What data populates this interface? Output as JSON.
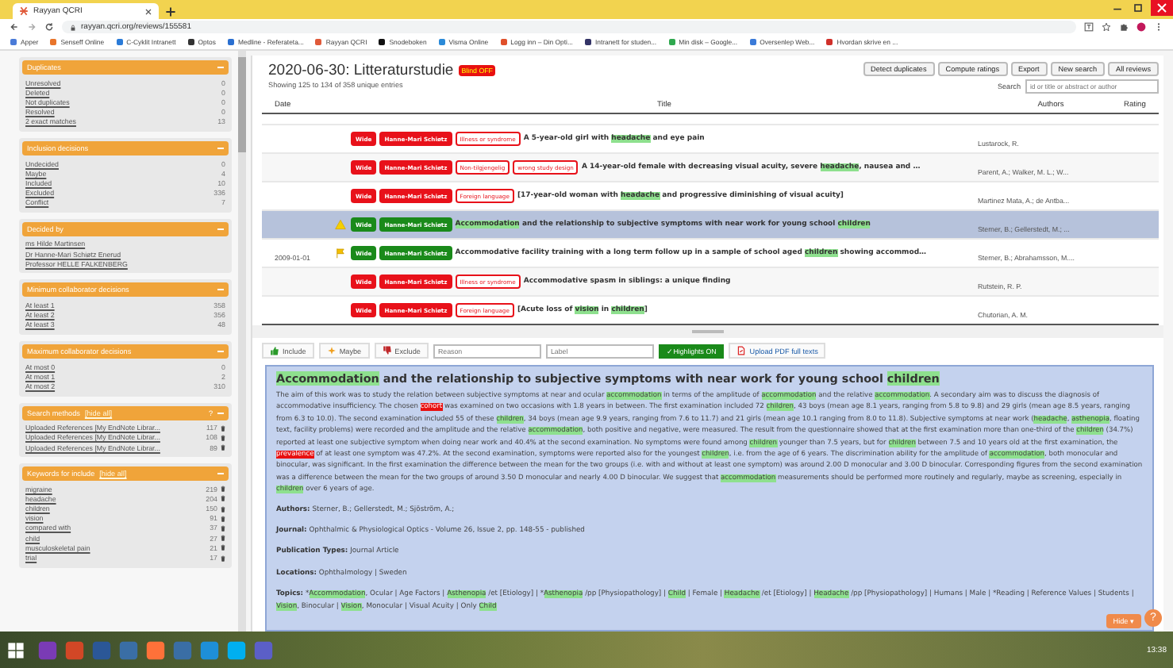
{
  "browser": {
    "tab": {
      "title": "Rayyan QCRI"
    },
    "url": "rayyan.qcri.org/reviews/155581",
    "bookmarks": [
      {
        "label": "Apper",
        "color": "#4a7bd8"
      },
      {
        "label": "Senseff Online",
        "color": "#e8742a"
      },
      {
        "label": "C-Cyklit Intranett",
        "color": "#2a7bd8"
      },
      {
        "label": "Optos",
        "color": "#333333"
      },
      {
        "label": "Medline - Referateta...",
        "color": "#2a6fd0"
      },
      {
        "label": "Rayyan QCRI",
        "color": "#e05a3a"
      },
      {
        "label": "Snodeboken",
        "color": "#111111"
      },
      {
        "label": "Visma Online",
        "color": "#2a8ad8"
      },
      {
        "label": "Logg inn – Din Opti...",
        "color": "#e0502a"
      },
      {
        "label": "Intranett for studen...",
        "color": "#333366"
      },
      {
        "label": "Min disk – Google...",
        "color": "#2fa84f"
      },
      {
        "label": "Oversenlep Web...",
        "color": "#3a7ad8"
      },
      {
        "label": "Hvordan skrive en ...",
        "color": "#d0302a"
      }
    ]
  },
  "sidebar": {
    "panels": [
      {
        "title": "Duplicates",
        "deletable": false,
        "items": [
          {
            "label": "Unresolved",
            "count": "0"
          },
          {
            "label": "Deleted",
            "count": "0"
          },
          {
            "label": "Not duplicates",
            "count": "0"
          },
          {
            "label": "Resolved",
            "count": "0"
          },
          {
            "label": "2 exact matches",
            "count": "13"
          }
        ]
      },
      {
        "title": "Inclusion decisions",
        "deletable": false,
        "items": [
          {
            "label": "Undecided",
            "count": "0"
          },
          {
            "label": "Maybe",
            "count": "4"
          },
          {
            "label": "Included",
            "count": "10"
          },
          {
            "label": "Excluded",
            "count": "336"
          },
          {
            "label": "Conflict",
            "count": "7"
          }
        ]
      },
      {
        "title": "Decided by",
        "deletable": false,
        "items": [
          {
            "label": "ms Hilde Martinsen"
          },
          {
            "label": "Dr Hanne-Mari Schiøtz Enerud"
          },
          {
            "label": "Professor HELLE FALKENBERG"
          }
        ]
      },
      {
        "title": "Minimum collaborator decisions",
        "deletable": false,
        "items": [
          {
            "label": "At least 1",
            "count": "358"
          },
          {
            "label": "At least 2",
            "count": "356"
          },
          {
            "label": "At least 3",
            "count": "48"
          }
        ]
      },
      {
        "title": "Maximum collaborator decisions",
        "deletable": false,
        "items": [
          {
            "label": "At most 0",
            "count": "0"
          },
          {
            "label": "At most 1",
            "count": "2"
          },
          {
            "label": "At most 2",
            "count": "310"
          }
        ]
      },
      {
        "title": "Search methods",
        "link": "[hide all]",
        "help": "?",
        "deletable": true,
        "items": [
          {
            "label": "Uploaded References [My EndNote Librar...",
            "count": "117"
          },
          {
            "label": "Uploaded References [My EndNote Librar...",
            "count": "108"
          },
          {
            "label": "Uploaded References [My EndNote Librar...",
            "count": "89"
          }
        ]
      },
      {
        "title": "Keywords for include",
        "link": "[hide all]",
        "deletable": true,
        "items": [
          {
            "label": "migraine",
            "count": "219"
          },
          {
            "label": "headache",
            "count": "204"
          },
          {
            "label": "children",
            "count": "150"
          },
          {
            "label": "vision",
            "count": "91"
          },
          {
            "label": "compared with",
            "count": "37"
          },
          {
            "label": "child",
            "count": "27"
          },
          {
            "label": "musculoskeletal pain",
            "count": "21"
          },
          {
            "label": "trial",
            "count": "17"
          }
        ]
      }
    ]
  },
  "review": {
    "title": "2020-06-30: Litteraturstudie",
    "blind_badge": "Blind OFF",
    "buttons": [
      "Detect duplicates",
      "Compute ratings",
      "Export",
      "New search",
      "All reviews"
    ],
    "showing": "Showing 125 to 134 of 358 unique entries",
    "search": {
      "label": "Search",
      "placeholder": "id or title or abstract or author"
    }
  },
  "table": {
    "columns": [
      "Date",
      "Title",
      "Authors",
      "Rating"
    ],
    "rows": [
      {
        "date": "",
        "kind": "plain",
        "selected": false,
        "tags": [
          {
            "kind": "decision",
            "label": "Wide",
            "color": "#e8111a"
          },
          {
            "kind": "decision",
            "label": "Hanne-Mari Schiøtz",
            "color": "#e8111a"
          },
          {
            "kind": "reason",
            "label": "Illness or syndrome",
            "color": "#e8111a"
          }
        ],
        "title": [
          {
            "kind": "plain",
            "text": "A 5-year-old girl with "
          },
          {
            "kind": "keyword",
            "text": "headache"
          },
          {
            "kind": "plain",
            "text": " and eye pain"
          }
        ],
        "authors": "Lustarock, R."
      },
      {
        "date": "",
        "kind": "plain",
        "selected": false,
        "tags": [
          {
            "kind": "decision",
            "label": "Wide",
            "color": "#e8111a"
          },
          {
            "kind": "decision",
            "label": "Hanne-Mari Schiøtz",
            "color": "#e8111a"
          },
          {
            "kind": "reason",
            "label": "Non-tilgjengelig",
            "color": "#e8111a"
          },
          {
            "kind": "reason",
            "label": "wrong study design",
            "color": "#e8111a"
          }
        ],
        "title": [
          {
            "kind": "plain",
            "text": "A 14-year-old female with decreasing visual acuity, severe "
          },
          {
            "kind": "keyword",
            "text": "headache"
          },
          {
            "kind": "plain",
            "text": ", nausea and …"
          }
        ],
        "authors": "Parent, A.; Walker, M. L.; W..."
      },
      {
        "date": "",
        "kind": "plain",
        "selected": false,
        "tags": [
          {
            "kind": "decision",
            "label": "Wide",
            "color": "#e8111a"
          },
          {
            "kind": "decision",
            "label": "Hanne-Mari Schiøtz",
            "color": "#e8111a"
          },
          {
            "kind": "reason",
            "label": "Foreign language",
            "color": "#e8111a"
          }
        ],
        "title": [
          {
            "kind": "plain",
            "text": "[17-year-old woman with "
          },
          {
            "kind": "keyword",
            "text": "headache"
          },
          {
            "kind": "plain",
            "text": " and progressive diminishing of visual acuity]"
          }
        ],
        "authors": "Martinez Mata, A.; de Antba..."
      },
      {
        "date": "",
        "kind": "warning",
        "selected": true,
        "tags": [
          {
            "kind": "decision",
            "label": "Wide",
            "color": "#1a8a1a"
          },
          {
            "kind": "decision",
            "label": "Hanne-Mari Schiøtz",
            "color": "#1a8a1a"
          }
        ],
        "title": [
          {
            "kind": "keyword",
            "text": "Accommodation"
          },
          {
            "kind": "plain",
            "text": " and the relationship to subjective symptoms with near work for young school "
          },
          {
            "kind": "keyword",
            "text": "children"
          }
        ],
        "authors": "Sterner, B.; Gellerstedt, M.; ..."
      },
      {
        "date": "2009-01-01",
        "kind": "flagged",
        "selected": false,
        "tags": [
          {
            "kind": "decision",
            "label": "Wide",
            "color": "#1a8a1a"
          },
          {
            "kind": "decision",
            "label": "Hanne-Mari Schiøtz",
            "color": "#1a8a1a"
          }
        ],
        "title": [
          {
            "kind": "plain",
            "text": "Accommodative facility training with a long term follow up in a sample of school aged "
          },
          {
            "kind": "keyword",
            "text": "children"
          },
          {
            "kind": "plain",
            "text": " showing accommod…"
          }
        ],
        "authors": "Sterner, B.; Abrahamsson, M...."
      },
      {
        "date": "",
        "kind": "plain",
        "selected": false,
        "tags": [
          {
            "kind": "decision",
            "label": "Wide",
            "color": "#e8111a"
          },
          {
            "kind": "decision",
            "label": "Hanne-Mari Schiøtz",
            "color": "#e8111a"
          },
          {
            "kind": "reason",
            "label": "Illness or syndrome",
            "color": "#e8111a"
          }
        ],
        "title": [
          {
            "kind": "plain",
            "text": "Accommodative spasm in siblings: a unique finding"
          }
        ],
        "authors": "Rutstein, R. P."
      },
      {
        "date": "",
        "kind": "plain",
        "selected": false,
        "tags": [
          {
            "kind": "decision",
            "label": "Wide",
            "color": "#e8111a"
          },
          {
            "kind": "decision",
            "label": "Hanne-Mari Schiøtz",
            "color": "#e8111a"
          },
          {
            "kind": "reason",
            "label": "Foreign language",
            "color": "#e8111a"
          }
        ],
        "title": [
          {
            "kind": "plain",
            "text": "[Acute loss of "
          },
          {
            "kind": "keyword",
            "text": "vision"
          },
          {
            "kind": "plain",
            "text": " in "
          },
          {
            "kind": "keyword",
            "text": "children"
          },
          {
            "kind": "plain",
            "text": "]"
          }
        ],
        "authors": "Chutorian, A. M."
      }
    ]
  },
  "toolbar": {
    "include": "Include",
    "maybe": "Maybe",
    "exclude": "Exclude",
    "reason_placeholder": "Reason",
    "label_placeholder": "Label",
    "highlights": "✓ Highlights ON",
    "upload": "Upload PDF full texts"
  },
  "detail": {
    "title": [
      {
        "kind": "keyword",
        "text": "Accommodation"
      },
      {
        "kind": "plain",
        "text": " and the relationship to subjective symptoms with near work for young school "
      },
      {
        "kind": "keyword",
        "text": "children"
      }
    ],
    "abstract": [
      {
        "kind": "plain",
        "text": "The aim of this work was to study the relation between subjective symptoms at near and ocular "
      },
      {
        "kind": "keyword",
        "text": "accommodation"
      },
      {
        "kind": "plain",
        "text": " in terms of the amplitude of "
      },
      {
        "kind": "keyword",
        "text": "accommodation"
      },
      {
        "kind": "plain",
        "text": " and the relative "
      },
      {
        "kind": "keyword",
        "text": "accommodation"
      },
      {
        "kind": "plain",
        "text": ". A secondary aim was to discuss the diagnosis of accommodative insufficiency. The chosen "
      },
      {
        "kind": "exclude-keyword",
        "text": "cohort"
      },
      {
        "kind": "plain",
        "text": " was examined on two occasions with 1.8 years in between. The first examination included 72 "
      },
      {
        "kind": "keyword",
        "text": "children"
      },
      {
        "kind": "plain",
        "text": ", 43 boys (mean age 8.1 years, ranging from 5.8 to 9.8) and 29 girls (mean age 8.5 years, ranging from 6.3 to 10.0). The second examination included 55 of these "
      },
      {
        "kind": "keyword",
        "text": "children"
      },
      {
        "kind": "plain",
        "text": ", 34 boys (mean age 9.9 years, ranging from 7.6 to 11.7) and 21 girls (mean age 10.1 ranging from 8.0 to 11.8). Subjective symptoms at near work ("
      },
      {
        "kind": "keyword",
        "text": "headache"
      },
      {
        "kind": "plain",
        "text": ", "
      },
      {
        "kind": "keyword",
        "text": "asthenopia"
      },
      {
        "kind": "plain",
        "text": ", floating text, facility problems) were recorded and the amplitude and the relative "
      },
      {
        "kind": "keyword",
        "text": "accommodation"
      },
      {
        "kind": "plain",
        "text": ", both positive and negative, were measured. The result from the questionnaire showed that at the first examination more than one-third of the "
      },
      {
        "kind": "keyword",
        "text": "children"
      },
      {
        "kind": "plain",
        "text": " (34.7%) reported at least one subjective symptom when doing near work and 40.4% at the second examination. No symptoms were found among "
      },
      {
        "kind": "keyword",
        "text": "children"
      },
      {
        "kind": "plain",
        "text": " younger than 7.5 years, but for "
      },
      {
        "kind": "keyword",
        "text": "children"
      },
      {
        "kind": "plain",
        "text": " between 7.5 and 10 years old at the first examination, the "
      },
      {
        "kind": "exclude-keyword",
        "text": "prevalence"
      },
      {
        "kind": "plain",
        "text": " of at least one symptom was 47.2%. At the second examination, symptoms were reported also for the youngest "
      },
      {
        "kind": "keyword",
        "text": "children"
      },
      {
        "kind": "plain",
        "text": ", i.e. from the age of 6 years. The discrimination ability for the amplitude of "
      },
      {
        "kind": "keyword",
        "text": "accommodation"
      },
      {
        "kind": "plain",
        "text": ", both monocular and binocular, was significant. In the first examination the difference between the mean for the two groups (i.e. with and without at least one symptom) was around 2.00 D monocular and 3.00 D binocular. Corresponding figures from the second examination was a difference between the mean for the two groups of around 3.50 D monocular and nearly 4.00 D binocular. We suggest that "
      },
      {
        "kind": "keyword",
        "text": "accommodation"
      },
      {
        "kind": "plain",
        "text": " measurements should be performed more routinely and regularly, maybe as screening, especially in "
      },
      {
        "kind": "keyword",
        "text": "children"
      },
      {
        "kind": "plain",
        "text": " over 6 years of age."
      }
    ],
    "fields": [
      {
        "label": "Authors:",
        "value": [
          {
            "kind": "plain",
            "text": "Sterner, B.; Gellerstedt, M.; Sjöström, A.;"
          }
        ]
      },
      {
        "label": "Journal:",
        "value": [
          {
            "kind": "plain",
            "text": "Ophthalmic & Physiological Optics - Volume 26, Issue 2, pp. 148-55 - published"
          }
        ]
      },
      {
        "label": "Publication Types:",
        "value": [
          {
            "kind": "plain",
            "text": "Journal Article"
          }
        ]
      },
      {
        "label": "Locations:",
        "value": [
          {
            "kind": "plain",
            "text": "Ophthalmology | Sweden"
          }
        ]
      },
      {
        "label": "Topics:",
        "value": [
          {
            "kind": "plain",
            "text": "*"
          },
          {
            "kind": "keyword",
            "text": "Accommodation"
          },
          {
            "kind": "plain",
            "text": ", Ocular | Age Factors | "
          },
          {
            "kind": "keyword",
            "text": "Asthenopia"
          },
          {
            "kind": "plain",
            "text": " /et [Etiology] | *"
          },
          {
            "kind": "keyword",
            "text": "Asthenopia"
          },
          {
            "kind": "plain",
            "text": " /pp [Physiopathology] | "
          },
          {
            "kind": "keyword",
            "text": "Child"
          },
          {
            "kind": "plain",
            "text": " | Female | "
          },
          {
            "kind": "keyword",
            "text": "Headache"
          },
          {
            "kind": "plain",
            "text": " /et [Etiology] | "
          },
          {
            "kind": "keyword",
            "text": "Headache"
          },
          {
            "kind": "plain",
            "text": " /pp [Physiopathology] | Humans | Male | *Reading | Reference Values | Students | "
          },
          {
            "kind": "keyword",
            "text": "Vision"
          },
          {
            "kind": "plain",
            "text": ", Binocular | "
          },
          {
            "kind": "keyword",
            "text": "Vision"
          },
          {
            "kind": "plain",
            "text": ", Monocular | Visual Acuity | Only "
          },
          {
            "kind": "keyword",
            "text": "Child"
          }
        ]
      }
    ]
  },
  "hide_button": "Hide ▾",
  "help_button": "?",
  "taskbar": {
    "apps": [
      {
        "color": "#7a3bb5"
      },
      {
        "color": "#d24726"
      },
      {
        "color": "#2b5797"
      },
      {
        "color": "#3a6ea5"
      },
      {
        "color": "#ff7139"
      },
      {
        "color": "#3a6ea5"
      },
      {
        "color": "#1e8fd8"
      },
      {
        "color": "#00aff0"
      },
      {
        "color": "#5b5fc7"
      }
    ],
    "time": "13:38"
  }
}
